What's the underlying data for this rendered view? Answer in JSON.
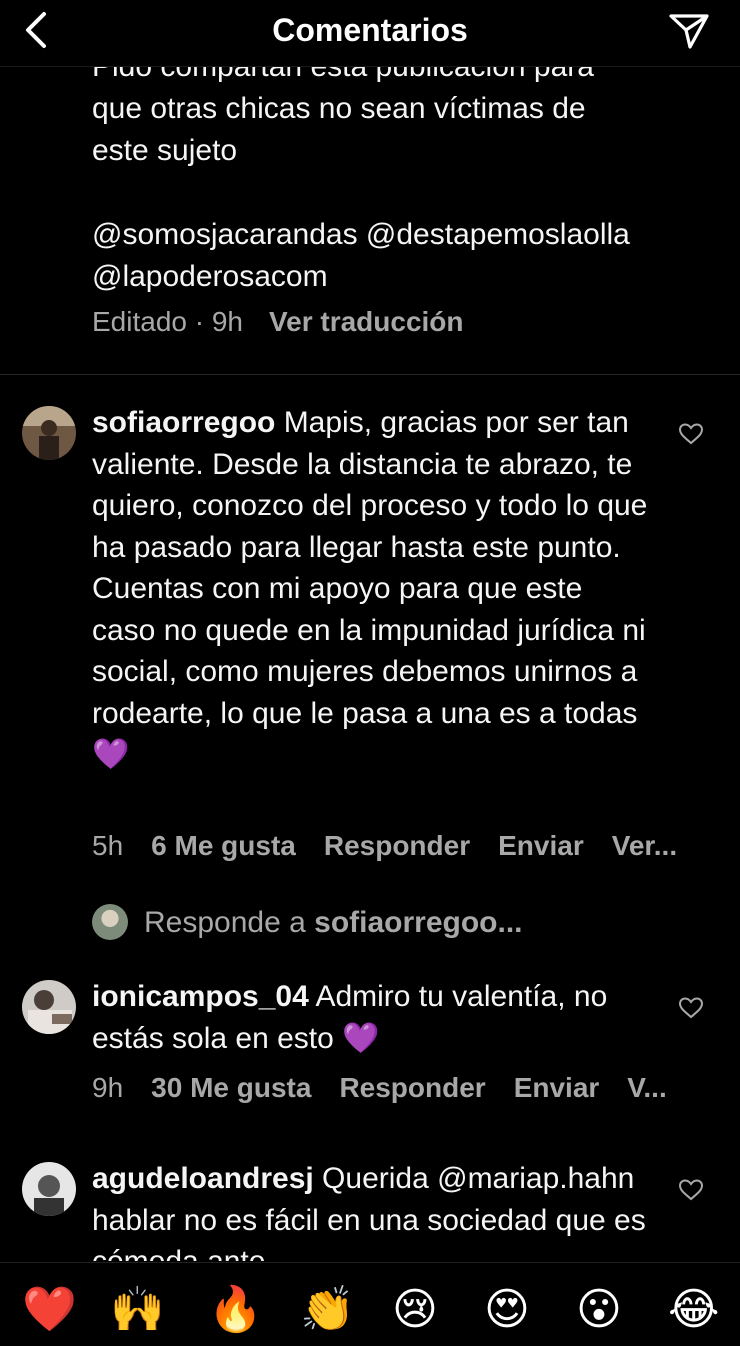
{
  "header": {
    "title": "Comentarios"
  },
  "caption": {
    "text": "Pido compartan esta publicación para\nque otras chicas no sean víctimas de\neste sujeto\n\n@somosjacarandas @destapemoslaolla\n@lapoderosacom",
    "meta_time": "Editado · 9h",
    "meta_translate": "Ver traducción"
  },
  "comments": [
    {
      "username": "sofiaorregoo",
      "text": " Mapis, gracias por ser tan valiente. Desde la distancia te abrazo, te quiero, conozco del proceso y todo lo que ha pasado para llegar hasta este punto. Cuentas con mi apoyo para que este caso no quede en la impunidad jurídica ni social, como mujeres debemos unirnos a rodearte, lo que le pasa a una es a todas ",
      "emoji": "💜",
      "time": "5h",
      "likes": "6 Me gusta",
      "reply": "Responder",
      "send": "Enviar",
      "more": "Ver..."
    },
    {
      "username": "ionicampos_04",
      "text": " Admiro tu valentía, no estás sola en esto ",
      "emoji": "💜",
      "time": "9h",
      "likes": "30 Me gusta",
      "reply": "Responder",
      "send": "Enviar",
      "more": "V..."
    },
    {
      "username": "agudeloandresj",
      "text": " Querida @mariap.hahn hablar no es fácil en una sociedad que es cómoda ante"
    }
  ],
  "reply_thread": {
    "prefix": "Responde a ",
    "username": "sofiaorregoo..."
  },
  "emoji_bar": [
    "❤️",
    "🙌",
    "🔥",
    "👏",
    "😢",
    "😍",
    "😮",
    "😂"
  ],
  "colors": {
    "background": "#000000",
    "text": "#ffffff",
    "secondary": "#a8a8a8",
    "heart_emoji": "#a64bf4"
  }
}
